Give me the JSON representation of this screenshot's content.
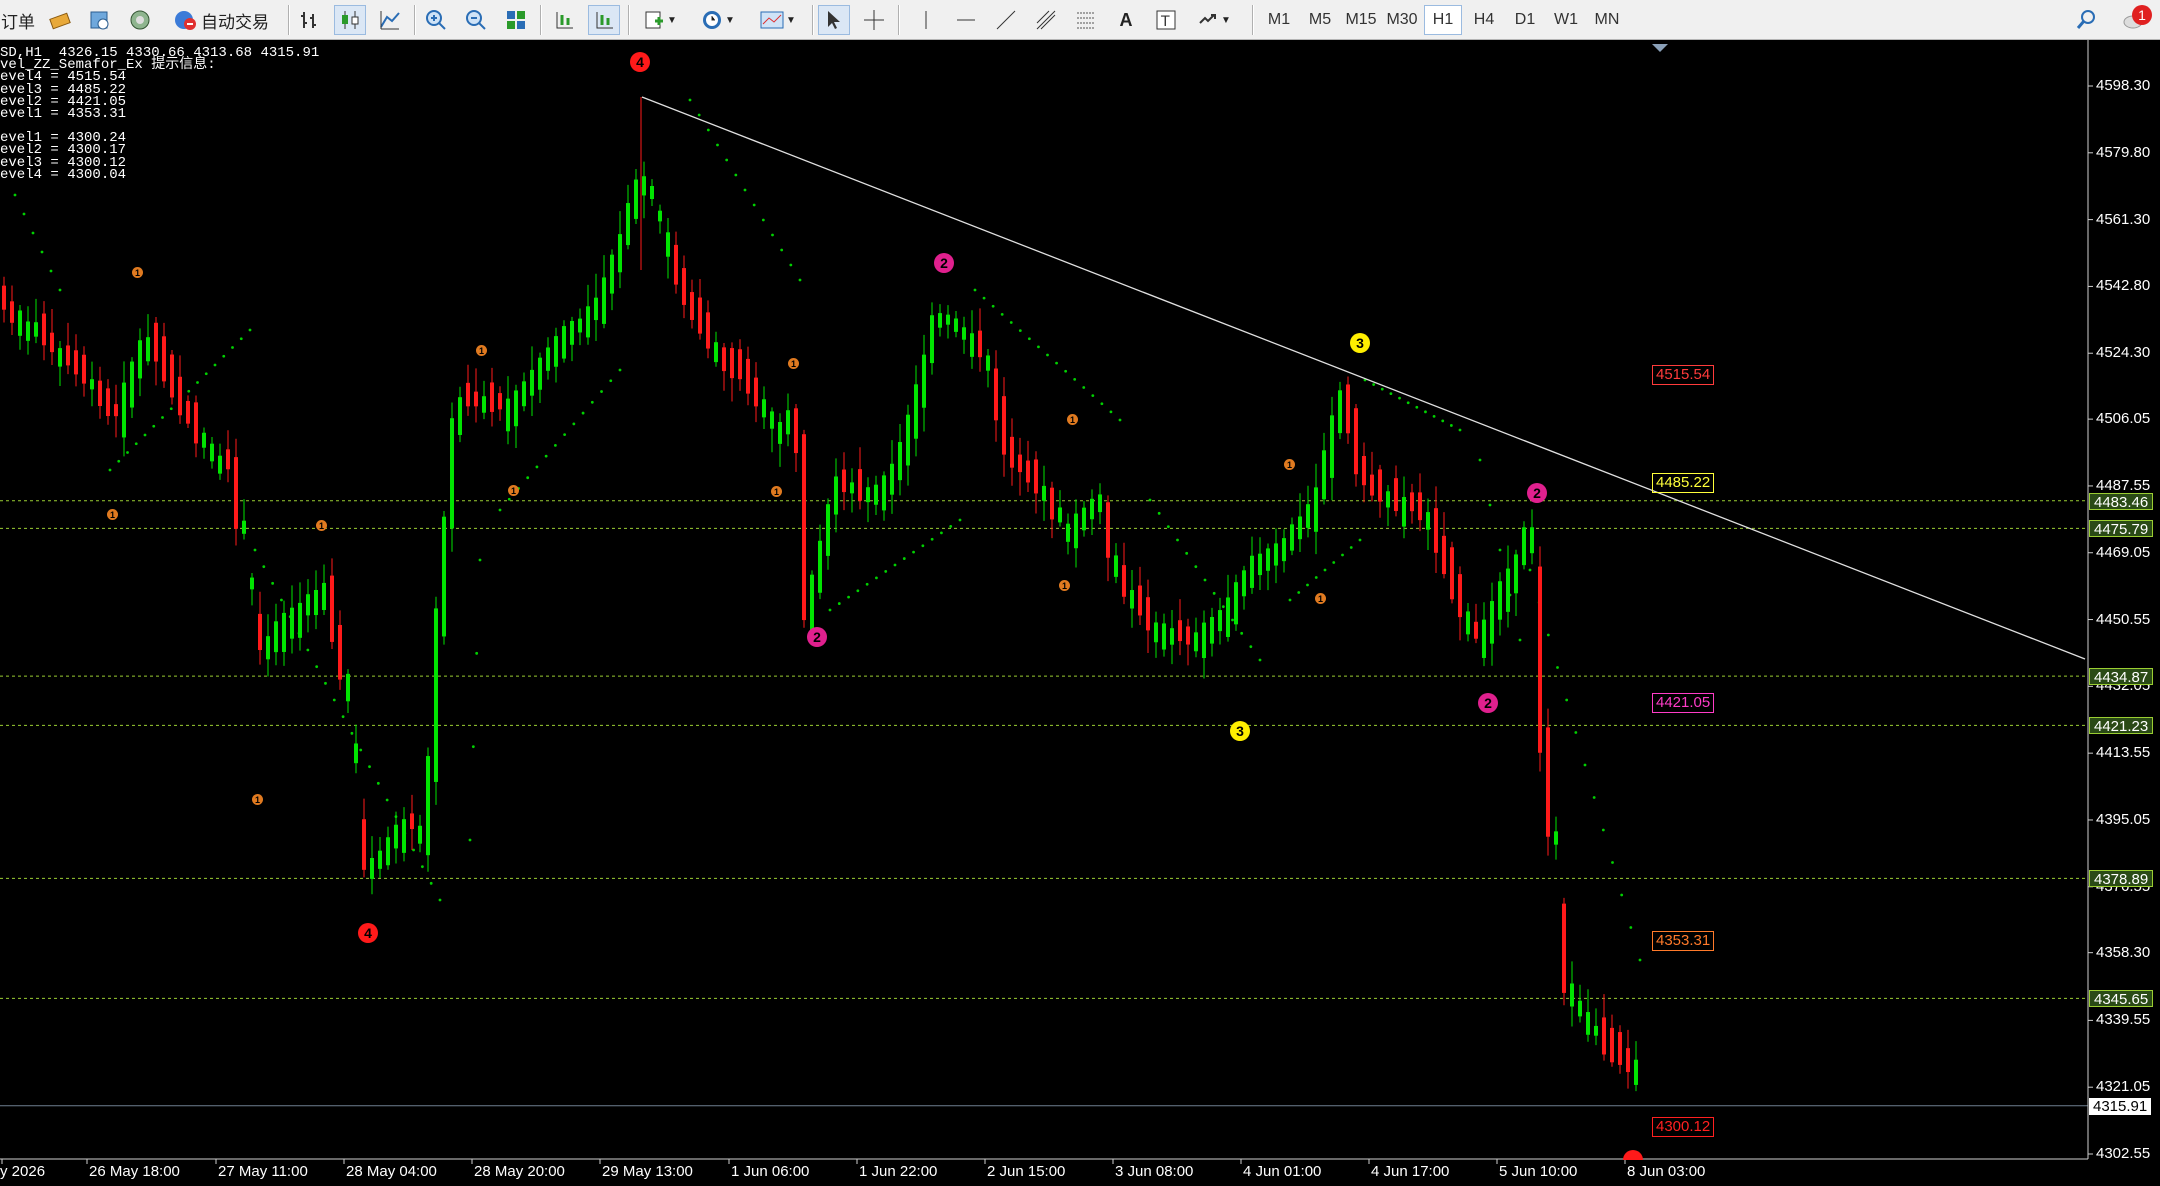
{
  "toolbar": {
    "order_label": "订单",
    "auto_trade_label": "自动交易",
    "timeframes": [
      "M1",
      "M5",
      "M15",
      "M30",
      "H1",
      "H4",
      "D1",
      "W1",
      "MN"
    ],
    "active_timeframe": "H1",
    "notification_count": "1"
  },
  "info_panel": {
    "header": "SD,H1  4326.15 4330.66 4313.68 4315.91",
    "indicator": "vel_ZZ_Semafor_Ex 提示信息:",
    "high_levels": [
      "evel4 = 4515.54",
      "evel3 = 4485.22",
      "evel2 = 4421.05",
      "evel1 = 4353.31"
    ],
    "low_levels": [
      "evel1 = 4300.24",
      "evel2 = 4300.17",
      "evel3 = 4300.12",
      "evel4 = 4300.04"
    ]
  },
  "price_axis": {
    "ticks": [
      "4598.30",
      "4579.80",
      "4561.30",
      "4542.80",
      "4524.30",
      "4506.05",
      "4487.55",
      "4469.05",
      "4450.55",
      "4432.05",
      "4413.55",
      "4395.05",
      "4376.55",
      "4358.30",
      "4339.55",
      "4321.05",
      "4302.55"
    ],
    "line_labels": [
      "4483.46",
      "4475.79",
      "4434.87",
      "4421.23",
      "4378.89",
      "4345.65"
    ],
    "current_price": "4315.91"
  },
  "time_axis": {
    "labels": [
      "y 2026",
      "26 May 18:00",
      "27 May 11:00",
      "28 May 04:00",
      "28 May 20:00",
      "29 May 13:00",
      "1 Jun 06:00",
      "1 Jun 22:00",
      "2 Jun 15:00",
      "3 Jun 08:00",
      "4 Jun 01:00",
      "4 Jun 17:00",
      "5 Jun 10:00",
      "8 Jun 03:00"
    ]
  },
  "level_labels": [
    {
      "text": "4515.54",
      "color": "#ff3b3b"
    },
    {
      "text": "4485.22",
      "color": "#ffff3a"
    },
    {
      "text": "4421.05",
      "color": "#ff3cc8"
    },
    {
      "text": "4353.31",
      "color": "#ff7a2a"
    },
    {
      "text": "4300.12",
      "color": "#ff2020"
    }
  ],
  "semafor_markers": [
    {
      "level": "4",
      "color": "#ff1a1a"
    },
    {
      "level": "4",
      "color": "#ff1a1a"
    },
    {
      "level": "3",
      "color": "#ffee00"
    },
    {
      "level": "3",
      "color": "#ffee00"
    },
    {
      "level": "2",
      "color": "#e0208e"
    },
    {
      "level": "2",
      "color": "#e0208e"
    },
    {
      "level": "2",
      "color": "#e0208e"
    },
    {
      "level": "2",
      "color": "#e0208e"
    },
    {
      "level": "1",
      "color": "#e07a20"
    }
  ],
  "colors": {
    "bull_candle": "#00e400",
    "bear_candle": "#ff1a1a",
    "grid_dashed": "#9acd32",
    "trendline": "#e0e0e0",
    "psar": "#00d000"
  }
}
